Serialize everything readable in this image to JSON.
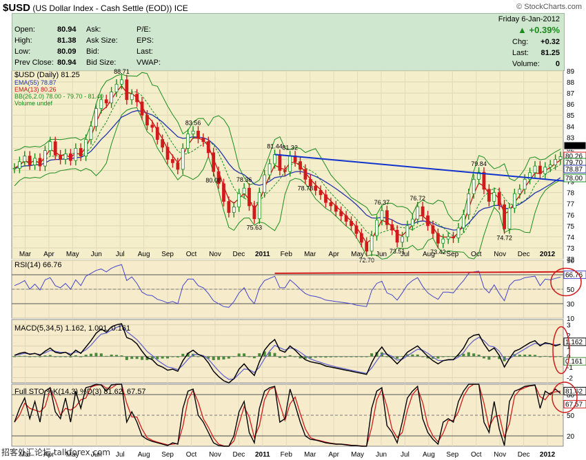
{
  "header": {
    "symbol": "$USD",
    "name": "(US Dollar Index - Cash Settle (EOD))",
    "exchange": "ICE",
    "credit": "© StockCharts.com"
  },
  "quote": {
    "date": "Friday  6-Jan-2012",
    "pct_change": "+0.39%",
    "rows": [
      {
        "label": "Open:",
        "value": "80.94",
        "label2": "Ask:",
        "label3": "P/E:",
        "rlabel": "",
        "rvalue": ""
      },
      {
        "label": "High:",
        "value": "81.38",
        "label2": "Ask Size:",
        "label3": "EPS:",
        "rlabel": "Chg:",
        "rvalue": "+0.32"
      },
      {
        "label": "Low:",
        "value": "80.09",
        "label2": "Bid:",
        "label3": "Last:",
        "rlabel": "Last:",
        "rvalue": "81.25"
      },
      {
        "label": "Prev Close:",
        "value": "80.94",
        "label2": "Bid Size:",
        "label3": "VWAP:",
        "rlabel": "Volume:",
        "rvalue": "0"
      }
    ]
  },
  "watermark": "招客外汇论坛 talkforex.com",
  "colors": {
    "price_bg": "#f4eecb",
    "ind_bg": "#f6ebcb",
    "up_bar": "#1a8c1a",
    "down_bar": "#d11a1a",
    "ema55": "#2233aa",
    "ema13": "#cc1111",
    "bb": "#1a8c1a",
    "trend": "#1133cc",
    "rsi": "#4444cc",
    "red": "#d11a1a"
  },
  "chart_data": [
    {
      "type": "line",
      "title": "$USD (Daily) 81.25",
      "legend": [
        "EMA(55) 78.87",
        "EMA(13) 80.26",
        "BB(26,2.0) 78.00 - 79.70 - 81.40",
        "Volume undef"
      ],
      "x_tick_labels": [
        "Mar",
        "Apr",
        "May",
        "Jun",
        "Jul",
        "Aug",
        "Sep",
        "Oct",
        "Nov",
        "Dec",
        "2011",
        "Feb",
        "Mar",
        "Apr",
        "May",
        "Jun",
        "Jul",
        "Aug",
        "Sep",
        "Oct",
        "Nov",
        "Dec",
        "2012"
      ],
      "y_range": [
        72,
        89
      ],
      "y_ticks": [
        72,
        73,
        74,
        75,
        76,
        77,
        78,
        79,
        80,
        81,
        82,
        83,
        84,
        85,
        86,
        87,
        88,
        89
      ],
      "close": [
        80.2,
        80.8,
        81.3,
        80.5,
        81.1,
        80.4,
        81.8,
        82.6,
        81.4,
        81.0,
        81.5,
        80.9,
        82.0,
        81.3,
        82.8,
        84.0,
        85.6,
        86.4,
        86.1,
        87.1,
        87.8,
        88.2,
        86.4,
        86.9,
        86.2,
        85.0,
        84.1,
        83.9,
        82.8,
        82.1,
        81.0,
        80.7,
        80.1,
        82.0,
        83.3,
        83.56,
        82.9,
        82.6,
        81.6,
        79.9,
        78.8,
        77.2,
        76.2,
        76.7,
        77.9,
        78.4,
        76.8,
        75.63,
        78.0,
        79.6,
        80.6,
        81.44,
        80.0,
        79.9,
        81.32,
        80.8,
        80.1,
        79.2,
        78.6,
        78.2,
        77.8,
        77.1,
        76.8,
        76.3,
        75.9,
        75.4,
        75.0,
        74.3,
        73.5,
        72.7,
        74.1,
        75.5,
        76.37,
        75.1,
        74.6,
        73.51,
        74.0,
        75.0,
        75.6,
        76.72,
        75.9,
        75.0,
        74.3,
        73.42,
        73.8,
        74.0,
        73.9,
        74.8,
        76.0,
        77.9,
        79.2,
        79.84,
        78.3,
        77.2,
        78.0,
        76.9,
        74.72,
        76.6,
        77.9,
        78.3,
        79.2,
        79.8,
        80.4,
        79.7,
        80.3,
        80.5,
        81.0,
        81.25
      ],
      "labels": [
        {
          "i": 21,
          "text": "88.71",
          "pos": "above"
        },
        {
          "i": 35,
          "text": "83.56",
          "pos": "above"
        },
        {
          "i": 39,
          "text": "80.08",
          "pos": "below"
        },
        {
          "i": 45,
          "text": "78.36",
          "pos": "above"
        },
        {
          "i": 47,
          "text": "75.63",
          "pos": "below"
        },
        {
          "i": 51,
          "text": "81.44",
          "pos": "above"
        },
        {
          "i": 54,
          "text": "81.32",
          "pos": "above"
        },
        {
          "i": 57,
          "text": "78.78",
          "pos": "below"
        },
        {
          "i": 69,
          "text": "72.70",
          "pos": "below"
        },
        {
          "i": 72,
          "text": "76.37",
          "pos": "above"
        },
        {
          "i": 75,
          "text": "73.51",
          "pos": "below"
        },
        {
          "i": 79,
          "text": "76.72",
          "pos": "above"
        },
        {
          "i": 83,
          "text": "73.42",
          "pos": "below"
        },
        {
          "i": 91,
          "text": "79.84",
          "pos": "above"
        },
        {
          "i": 96,
          "text": "74.72",
          "pos": "below"
        }
      ],
      "last_labels": [
        {
          "text": "81.25",
          "value": 81.25,
          "style": "black"
        },
        {
          "text": "80.26",
          "value": 80.26,
          "style": "red"
        },
        {
          "text": "79.70",
          "value": 79.7,
          "style": "green"
        },
        {
          "text": "78.87",
          "value": 78.87,
          "style": "blue"
        },
        {
          "text": "78.00",
          "value": 78.0,
          "style": "green"
        }
      ],
      "trendline": {
        "from": {
          "i": 51,
          "y": 81.44
        },
        "to": {
          "i": 107,
          "y": 79.0
        }
      }
    },
    {
      "type": "line",
      "title": "RSI(14) 66.76",
      "y_range": [
        10,
        90
      ],
      "y_ticks": [
        10,
        30,
        50,
        70,
        90
      ],
      "values": [
        55,
        58,
        62,
        50,
        57,
        49,
        63,
        66,
        55,
        52,
        58,
        50,
        63,
        55,
        68,
        72,
        76,
        78,
        74,
        79,
        82,
        84,
        62,
        67,
        58,
        46,
        42,
        41,
        36,
        34,
        31,
        33,
        30,
        55,
        64,
        64,
        55,
        52,
        44,
        34,
        30,
        26,
        25,
        33,
        45,
        52,
        38,
        30,
        52,
        62,
        65,
        68,
        52,
        52,
        63,
        57,
        50,
        44,
        41,
        40,
        38,
        35,
        34,
        33,
        32,
        31,
        30,
        28,
        27,
        26,
        48,
        58,
        61,
        45,
        42,
        35,
        45,
        56,
        62,
        66,
        54,
        45,
        40,
        36,
        46,
        46,
        45,
        54,
        62,
        72,
        74,
        75,
        52,
        45,
        56,
        44,
        34,
        55,
        62,
        63,
        66,
        67,
        68,
        55,
        64,
        63,
        65,
        66.76
      ],
      "last_labels": [
        {
          "text": "66.76",
          "value": 66.76
        }
      ]
    },
    {
      "type": "line",
      "title": "MACD(5,34,5) 1.162, 1.001, 0.161",
      "y_range": [
        -2.5,
        3.5
      ],
      "y_ticks": [
        -2,
        -1,
        0,
        1,
        2,
        3
      ],
      "macd": [
        0.1,
        0.3,
        0.4,
        0.2,
        0.3,
        0.1,
        0.5,
        0.8,
        0.4,
        0.3,
        0.4,
        0.1,
        0.6,
        0.3,
        0.9,
        1.5,
        2.2,
        2.6,
        2.3,
        2.8,
        3.0,
        3.1,
        1.8,
        1.6,
        1.2,
        0.5,
        -0.1,
        -0.3,
        -0.8,
        -1.0,
        -1.3,
        -1.2,
        -1.4,
        -0.4,
        0.3,
        0.6,
        0.2,
        0.0,
        -0.6,
        -1.4,
        -1.9,
        -2.3,
        -2.5,
        -2.1,
        -1.2,
        -0.7,
        -1.3,
        -1.8,
        -0.5,
        0.6,
        1.2,
        1.6,
        0.6,
        0.4,
        1.0,
        0.6,
        0.1,
        -0.3,
        -0.5,
        -0.6,
        -0.7,
        -0.9,
        -1.0,
        -1.1,
        -1.2,
        -1.3,
        -1.4,
        -1.5,
        -1.6,
        -1.7,
        -0.6,
        0.3,
        0.9,
        0.2,
        -0.2,
        -0.7,
        -0.2,
        0.4,
        0.7,
        1.0,
        0.5,
        0.0,
        -0.4,
        -0.7,
        -0.4,
        -0.3,
        -0.3,
        0.2,
        0.8,
        1.7,
        2.0,
        2.1,
        1.2,
        0.5,
        0.8,
        0.1,
        -1.0,
        -0.2,
        0.5,
        0.7,
        1.0,
        1.3,
        1.5,
        1.0,
        1.3,
        1.2,
        1.0,
        1.162
      ],
      "signal_value": 1.001,
      "hist_value": 0.161,
      "last_labels": [
        {
          "text": "1.162",
          "value": 1.162
        },
        {
          "text": "0.161",
          "value": 0.161
        }
      ]
    },
    {
      "type": "line",
      "title": "Full STO %K(14,3) %D(3) 81.62, 67.57",
      "y_range": [
        5,
        95
      ],
      "y_ticks": [
        20,
        50,
        80
      ],
      "k": [
        40,
        60,
        75,
        45,
        70,
        40,
        85,
        90,
        55,
        45,
        75,
        40,
        85,
        60,
        90,
        92,
        95,
        94,
        85,
        94,
        95,
        95,
        40,
        55,
        40,
        20,
        15,
        12,
        10,
        8,
        6,
        10,
        8,
        60,
        85,
        88,
        50,
        40,
        25,
        10,
        6,
        5,
        5,
        20,
        55,
        70,
        25,
        10,
        60,
        85,
        90,
        92,
        40,
        45,
        88,
        65,
        40,
        20,
        15,
        14,
        12,
        10,
        9,
        8,
        8,
        7,
        6,
        6,
        5,
        5,
        60,
        85,
        90,
        35,
        25,
        10,
        40,
        75,
        85,
        92,
        45,
        25,
        15,
        8,
        40,
        45,
        40,
        70,
        85,
        95,
        95,
        95,
        40,
        25,
        70,
        30,
        6,
        70,
        85,
        88,
        92,
        93,
        94,
        60,
        85,
        80,
        88,
        81.62
      ],
      "d_value": 67.57,
      "last_labels": [
        {
          "text": "81.62",
          "value": 81.62
        },
        {
          "text": "67.57",
          "value": 67.57
        }
      ]
    }
  ]
}
